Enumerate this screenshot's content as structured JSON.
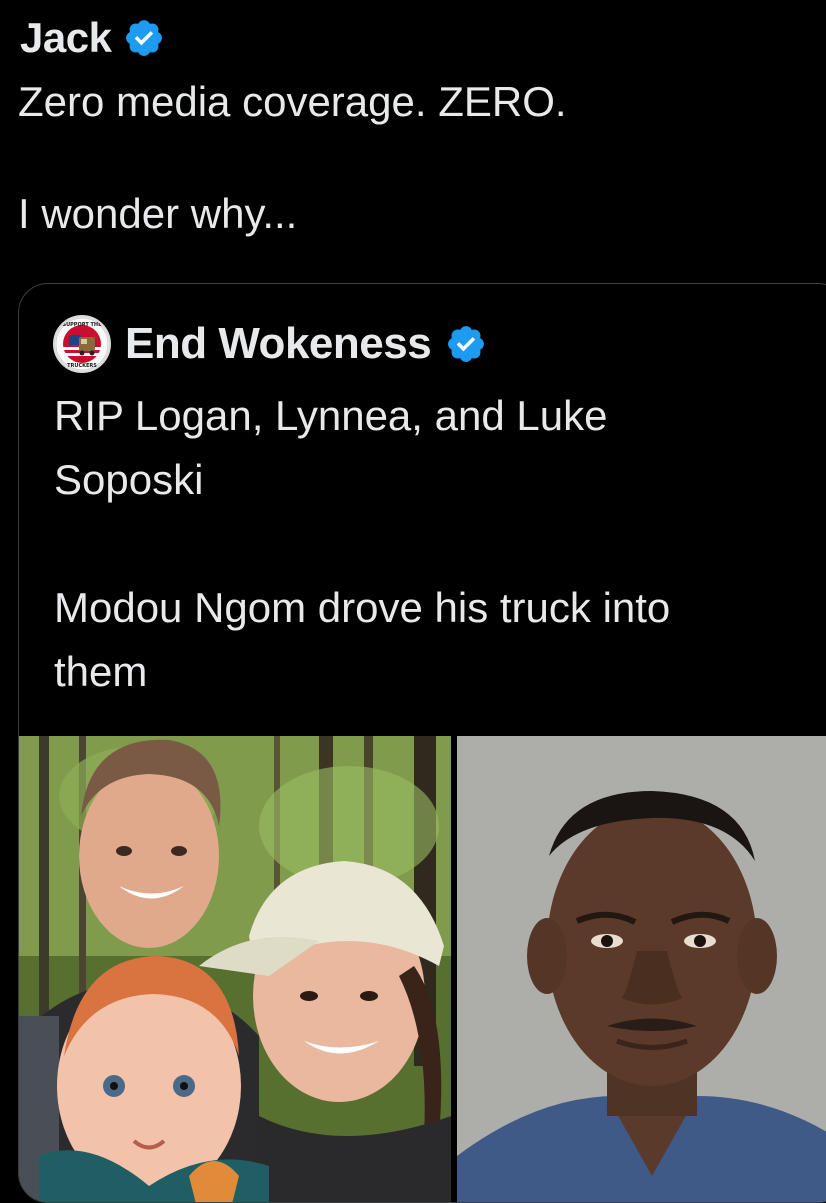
{
  "tweet": {
    "author_name": "Jack",
    "text": "Zero media coverage. ZERO.\n\nI wonder why..."
  },
  "quoted_tweet": {
    "author_name": "End Wokeness",
    "text": "RIP Logan, Lynnea, and Luke\nSoposki\n\nModou Ngom drove his truck into\nthem",
    "avatar_text": "SUPPORT THE TRUCKERS"
  },
  "colors": {
    "background": "#000000",
    "text": "#e7e9ea",
    "verified_badge": "#1d9bf0",
    "border": "#3a3f44"
  },
  "icons": {
    "verified": "verified-badge-icon"
  }
}
